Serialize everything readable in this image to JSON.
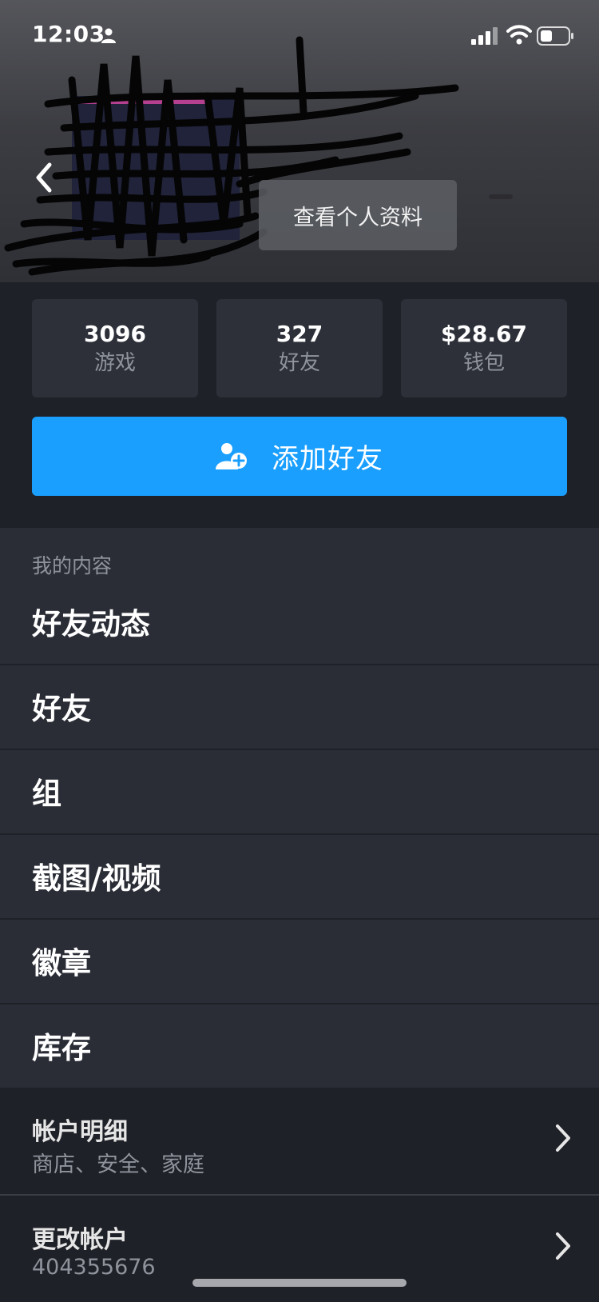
{
  "status_bar": {
    "time": "12:03"
  },
  "header": {
    "view_profile_label": "查看个人资料"
  },
  "stats": [
    {
      "value": "3096",
      "label": "游戏"
    },
    {
      "value": "327",
      "label": "好友"
    },
    {
      "value": "$28.67",
      "label": "钱包"
    }
  ],
  "add_friend": {
    "label": "添加好友"
  },
  "content_section": {
    "title": "我的内容",
    "items": [
      "好友动态",
      "好友",
      "组",
      "截图/视频",
      "徽章",
      "库存"
    ]
  },
  "account_details": {
    "title": "帐户明细",
    "subtitle": "商店、安全、家庭"
  },
  "change_account": {
    "title": "更改帐户",
    "subtitle": "404355676"
  },
  "colors": {
    "accent": "#1a9fff",
    "background": "#2a2d36",
    "panel": "#1f2128",
    "muted_text": "#8f939b"
  }
}
